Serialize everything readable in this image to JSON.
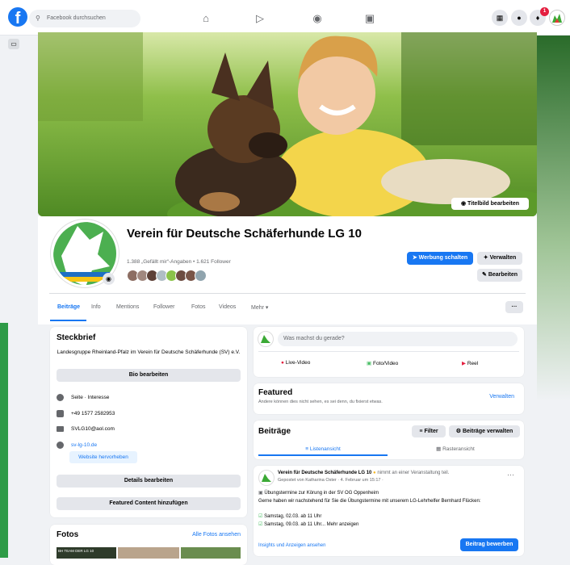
{
  "topbar": {
    "search_placeholder": "Facebook durchsuchen",
    "notification_count": "1"
  },
  "cover": {
    "edit_cover_label": "Titelbild bearbeiten"
  },
  "profile": {
    "name": "Verein für Deutsche Schäferhunde LG 10",
    "stats": "1.388 „Gefällt mir“-Angaben • 1.621 Follower",
    "buttons": {
      "advertise": "Werbung schalten",
      "manage": "Verwalten",
      "edit": "Bearbeiten"
    }
  },
  "tabs": [
    "Beiträge",
    "Info",
    "Mentions",
    "Follower",
    "Fotos",
    "Videos",
    "Mehr ▾"
  ],
  "tabs_more": "···",
  "intro": {
    "title": "Steckbrief",
    "bio": "Landesgruppe Rheinland-Pfalz im Verein für Deutsche Schäferhunde (SV) e.V.",
    "edit_bio": "Bio bearbeiten",
    "items": [
      {
        "icon": "info-icon",
        "text": "Seite · Interesse"
      },
      {
        "icon": "phone-icon",
        "text": "+49 1577 2582953"
      },
      {
        "icon": "mail-icon",
        "text": "SVLG10@aol.com"
      },
      {
        "icon": "globe-icon",
        "text": "sv-lg-10.de"
      }
    ],
    "highlight_website": "Website hervorheben",
    "edit_details": "Details bearbeiten",
    "add_featured": "Featured Content hinzufügen"
  },
  "photos": {
    "title": "Fotos",
    "all_link": "Alle Fotos ansehen",
    "thumb_caption": "BH TEAM DER LG 10"
  },
  "composer": {
    "placeholder": "Was machst du gerade?",
    "actions": [
      "Live-Video",
      "Foto/Video",
      "Reel"
    ]
  },
  "featured": {
    "title": "Featured",
    "subtitle": "Andere können dies nicht sehen, es sei denn, du fixierst etwas.",
    "manage": "Verwalten"
  },
  "posts": {
    "title": "Beiträge",
    "filter": "Filter",
    "manage_posts": "Beiträge verwalten",
    "list_view": "Listenansicht",
    "grid_view": "Rasteransicht"
  },
  "post": {
    "author": "Verein für Deutsche Schäferhunde LG 10",
    "action": "nimmt an einer Veranstaltung teil.",
    "meta": "Gepostet von Katharina Oster · 4. Februar um 15:17 ·",
    "lines": [
      "Übungstermine zur Körung in der SV OG Oppenheim",
      "Gerne haben wir nachstehend für Sie die Übungstermine mit unserem LG-Lehrhelfer Bernhard Flücken:",
      "Samstag, 02.03. ab 11 Uhr",
      "Samstag, 09.03. ab 11 Uhr... Mehr anzeigen"
    ],
    "insights": "Insights und Anzeigen ansehen",
    "boost": "Beitrag bewerben"
  }
}
